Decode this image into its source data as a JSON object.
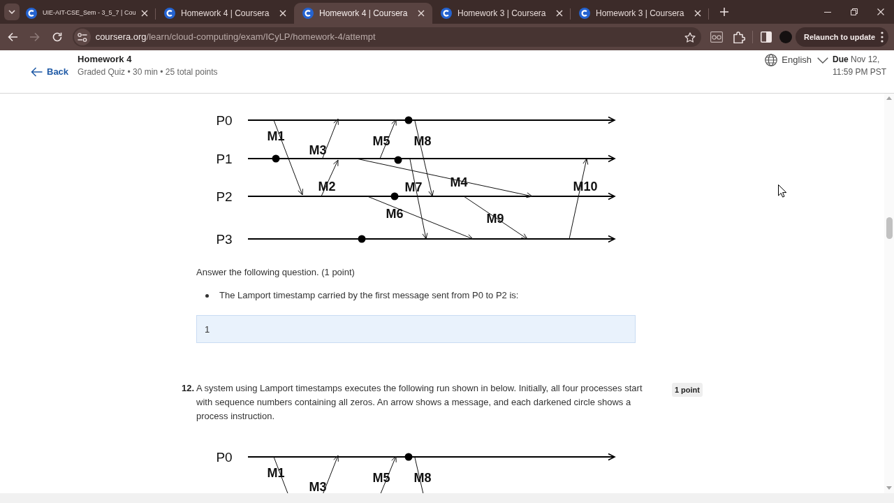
{
  "browser": {
    "tabs": [
      {
        "title": "UIE-AIT-CSE_Sem - 3_5_7 | Cou",
        "selected": false
      },
      {
        "title": "Homework 4 | Coursera",
        "selected": false
      },
      {
        "title": "Homework 4 | Coursera",
        "selected": true
      },
      {
        "title": "Homework 3 | Coursera",
        "selected": false
      },
      {
        "title": "Homework 3 | Coursera",
        "selected": false
      }
    ],
    "forward": {
      "disabled": true
    },
    "address_bar": {
      "host": "coursera.org",
      "path": "/learn/cloud-computing/exam/ICyLP/homework-4/attempt"
    },
    "relaunch_button": "Relaunch to update"
  },
  "header": {
    "back": "Back",
    "title": "Homework 4",
    "subtitle": "Graded Quiz • 30 min • 25 total points",
    "language": "English",
    "due": "**Due** Nov 12, 11:59 PM PST"
  },
  "questions": [
    {
      "diagram": {
        "processes": [
          {
            "label": "P0"
          },
          {
            "label": "P1"
          },
          {
            "label": "P2"
          },
          {
            "label": "P3"
          }
        ],
        "messages": [
          {
            "label": "M1"
          },
          {
            "label": "M2"
          },
          {
            "label": "M3"
          },
          {
            "label": "M4"
          },
          {
            "label": "M5"
          },
          {
            "label": "M6"
          },
          {
            "label": "M7"
          },
          {
            "label": "M8"
          },
          {
            "label": "M9"
          },
          {
            "label": "M10"
          }
        ]
      },
      "instruction": "Answer the following question. (1 point)",
      "bullets": [
        "The Lamport timestamp carried by the first message sent from P0 to P2 is:"
      ],
      "answer": {
        "value": "1"
      }
    },
    {
      "number": "12.",
      "text": "A system using Lamport timestamps executes the following run shown in below. Initially, all four processes start with sequence numbers containing all zeros. An arrow shows a message, and each darkened circle shows a process instruction.",
      "points": "1 point",
      "diagram": {
        "processes": [
          {
            "label": "P0"
          }
        ],
        "messages": [
          {
            "label": "M1"
          },
          {
            "label": "M3"
          },
          {
            "label": "M5"
          },
          {
            "label": "M8"
          }
        ]
      }
    }
  ]
}
